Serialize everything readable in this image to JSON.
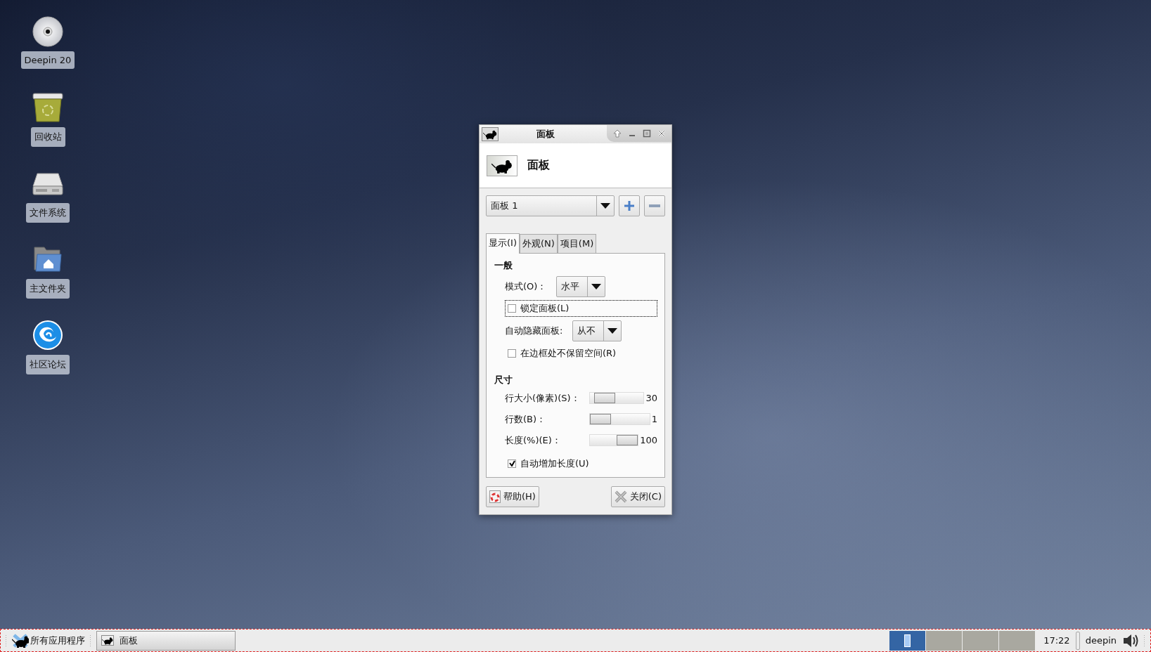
{
  "desktop_icons": [
    {
      "kind": "disc",
      "label": "Deepin 20"
    },
    {
      "kind": "trash",
      "label": "回收站"
    },
    {
      "kind": "drive",
      "label": "文件系统"
    },
    {
      "kind": "home",
      "label": "主文件夹"
    },
    {
      "kind": "logo",
      "label": "社区论坛"
    }
  ],
  "dialog": {
    "title": "面板",
    "heading": "面板",
    "panel_select": {
      "value": "面板 1"
    },
    "tabs": [
      {
        "label": "显示(I)",
        "selected": true
      },
      {
        "label": "外观(N)",
        "selected": false
      },
      {
        "label": "项目(M)",
        "selected": false
      }
    ],
    "sections": [
      {
        "heading": "一般",
        "items": [
          {
            "kind": "combo",
            "label": "模式(O)：",
            "value": "水平"
          },
          {
            "kind": "checkbox",
            "label": "锁定面板(L)",
            "checked": false,
            "focused": true
          },
          {
            "kind": "combo",
            "label": "自动隐藏面板:",
            "value": "从不"
          },
          {
            "kind": "checkbox",
            "label": "在边框处不保留空间(R)",
            "checked": false,
            "focused": false
          }
        ]
      },
      {
        "heading": "尺寸",
        "items": [
          {
            "kind": "slider",
            "label": "行大小(像素)(S)：",
            "level": 0.12,
            "reading": "30"
          },
          {
            "kind": "slider",
            "label": "行数(B)：",
            "level": 0,
            "reading": "1"
          },
          {
            "kind": "slider",
            "label": "长度(%)(E)：",
            "level": 1,
            "reading": "100"
          },
          {
            "kind": "checkbox",
            "label": "自动增加长度(U)",
            "checked": true,
            "focused": false
          }
        ]
      }
    ],
    "buttons": [
      {
        "kind": "help",
        "label": "帮助(H)"
      },
      {
        "kind": "close",
        "label": "关闭(C)"
      }
    ]
  },
  "taskbar": {
    "menu_button": "所有应用程序",
    "tasks": [
      {
        "label": "面板"
      }
    ],
    "workspaces": [
      {
        "selected": true
      },
      {
        "selected": false
      },
      {
        "selected": false
      },
      {
        "selected": false
      }
    ],
    "clock": "17:22",
    "user": "deepin"
  }
}
